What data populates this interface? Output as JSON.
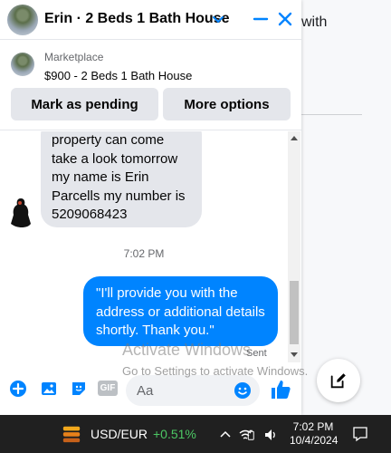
{
  "background": {
    "partial_text": "with"
  },
  "chat_header": {
    "title": "Erin · 2 Beds 1 Bath House"
  },
  "marketplace": {
    "label": "Marketplace",
    "listing": "$900 - 2 Beds 1 Bath House",
    "mark_pending_label": "Mark as pending",
    "more_options_label": "More options"
  },
  "messages": {
    "incoming_lines": [
      "property  can come",
      "take a look tomorrow",
      "my name is Erin",
      "Parcells my number is",
      "5209068423"
    ],
    "timestamp": "7:02 PM",
    "outgoing_lines": [
      "\"I'll provide you with the",
      "address or additional details",
      "shortly. Thank you.\""
    ],
    "status": "Sent"
  },
  "composer": {
    "placeholder": "Aa",
    "gif_label": "GIF"
  },
  "watermark": {
    "line1": "Activate Windows",
    "line2": "Go to Settings to activate Windows."
  },
  "taskbar": {
    "ticker": "USD/EUR",
    "change": "+0.51%",
    "time": "7:02 PM",
    "date": "10/4/2024"
  },
  "colors": {
    "accent": "#0084ff",
    "positive": "#4cc764"
  }
}
